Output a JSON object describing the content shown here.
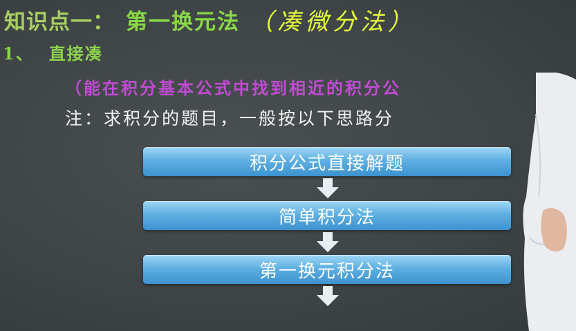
{
  "slide": {
    "title_prefix": "知识点一：",
    "title_main": "第一换元法",
    "title_handwritten": "（凑微分法）",
    "item1_number": "1、",
    "item1_heading": "直接凑",
    "note_purple": "（能在积分基本公式中找到相近的积分公",
    "note_white": "注：求积分的题目，一般按以下思路分",
    "flow": [
      {
        "label": "积分公式直接解题"
      },
      {
        "label": "简单积分法"
      },
      {
        "label": "第一换元积分法"
      }
    ]
  },
  "colors": {
    "background": "#3f4547",
    "title_green": "#8ad846",
    "handwriting_yellow": "#e6ff3a",
    "note_purple": "#c24bd4",
    "flow_blue": "#5fb0e3"
  }
}
